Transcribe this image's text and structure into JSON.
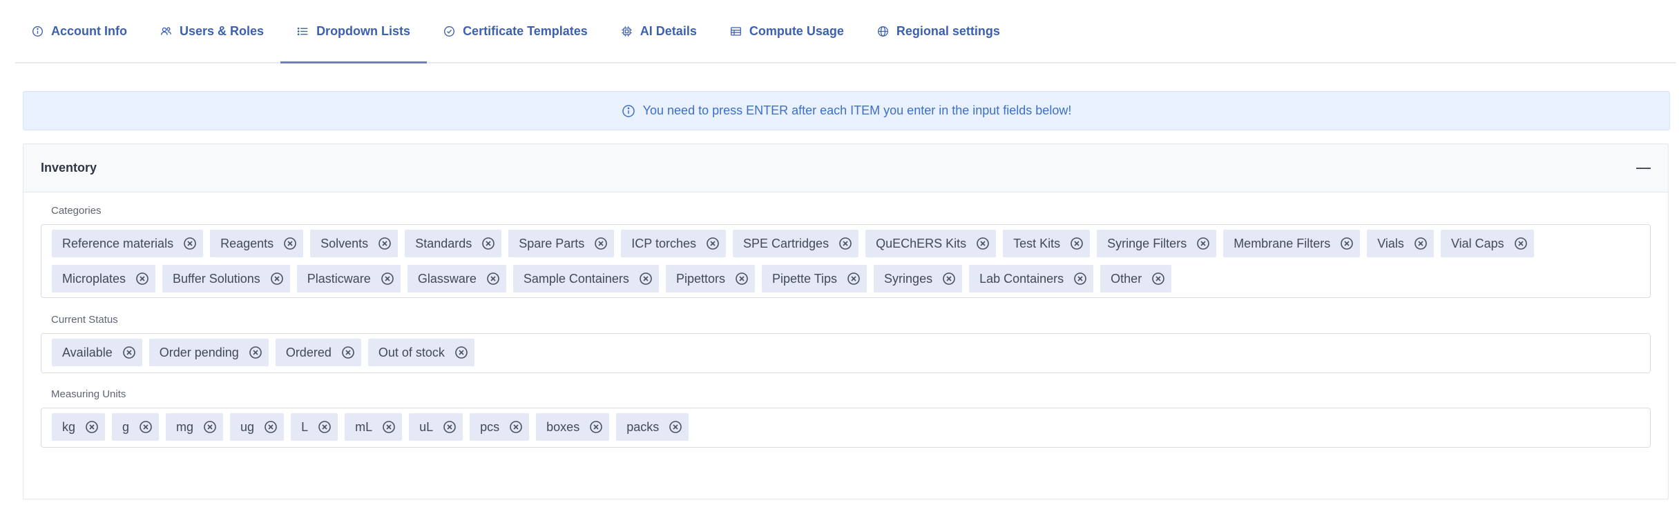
{
  "tabs": [
    {
      "label": "Account Info",
      "icon": "info-icon"
    },
    {
      "label": "Users & Roles",
      "icon": "users-icon"
    },
    {
      "label": "Dropdown Lists",
      "icon": "list-icon"
    },
    {
      "label": "Certificate Templates",
      "icon": "check-circle-icon"
    },
    {
      "label": "AI Details",
      "icon": "chip-icon"
    },
    {
      "label": "Compute Usage",
      "icon": "table-icon"
    },
    {
      "label": "Regional settings",
      "icon": "globe-icon"
    }
  ],
  "active_tab": "Dropdown Lists",
  "notice": {
    "text": "You need to press ENTER after each ITEM you enter in the input fields below!"
  },
  "panel": {
    "title": "Inventory",
    "fields": [
      {
        "label": "Categories",
        "tags": [
          "Reference materials",
          "Reagents",
          "Solvents",
          "Standards",
          "Spare Parts",
          "ICP torches",
          "SPE Cartridges",
          "QuEChERS Kits",
          "Test Kits",
          "Syringe Filters",
          "Membrane Filters",
          "Vials",
          "Vial Caps",
          "Microplates",
          "Buffer Solutions",
          "Plasticware",
          "Glassware",
          "Sample Containers",
          "Pipettors",
          "Pipette Tips",
          "Syringes",
          "Lab Containers",
          "Other"
        ]
      },
      {
        "label": "Current Status",
        "tags": [
          "Available",
          "Order pending",
          "Ordered",
          "Out of stock"
        ]
      },
      {
        "label": "Measuring Units",
        "tags": [
          "kg",
          "g",
          "mg",
          "ug",
          "L",
          "mL",
          "uL",
          "pcs",
          "boxes",
          "packs"
        ]
      }
    ]
  },
  "colors": {
    "accent": "#3c5fb0",
    "notice_bg": "#e8f1fd",
    "tag_bg": "#e5e8f5"
  }
}
